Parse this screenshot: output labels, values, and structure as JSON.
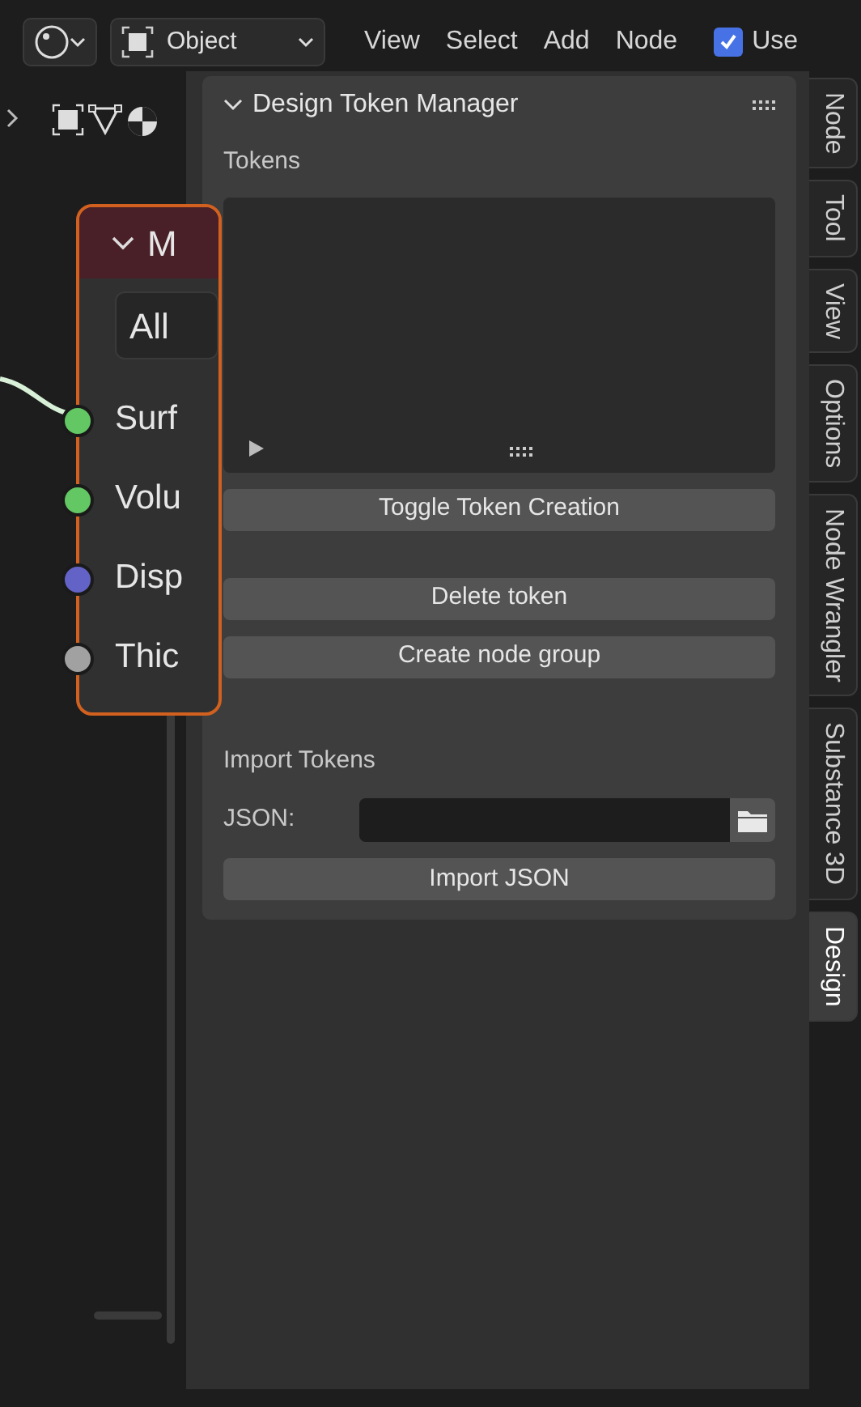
{
  "header": {
    "mode_dropdown": "Object",
    "menus": [
      "View",
      "Select",
      "Add",
      "Node"
    ],
    "use_nodes": {
      "label": "Use",
      "checked": true
    }
  },
  "node": {
    "title": "M",
    "dropdown": "All",
    "sockets": [
      {
        "label": "Surf",
        "color": "#63c763"
      },
      {
        "label": "Volu",
        "color": "#63c763"
      },
      {
        "label": "Disp",
        "color": "#6363c7"
      },
      {
        "label": "Thic",
        "color": "#a1a1a1"
      }
    ]
  },
  "panel": {
    "title": "Design Token Manager",
    "expanded": true,
    "tokens_label": "Tokens",
    "toggle_button": "Toggle Token Creation",
    "buttons": [
      "Delete token",
      "Create node group"
    ],
    "import_label": "Import Tokens",
    "json_label": "JSON:",
    "import_button": "Import JSON"
  },
  "tabs": [
    {
      "label": "Node",
      "selected": false
    },
    {
      "label": "Tool",
      "selected": false
    },
    {
      "label": "View",
      "selected": false
    },
    {
      "label": "Options",
      "selected": false
    },
    {
      "label": "Node Wrangler",
      "selected": false
    },
    {
      "label": "Substance 3D",
      "selected": false
    },
    {
      "label": "Design",
      "selected": true
    }
  ]
}
